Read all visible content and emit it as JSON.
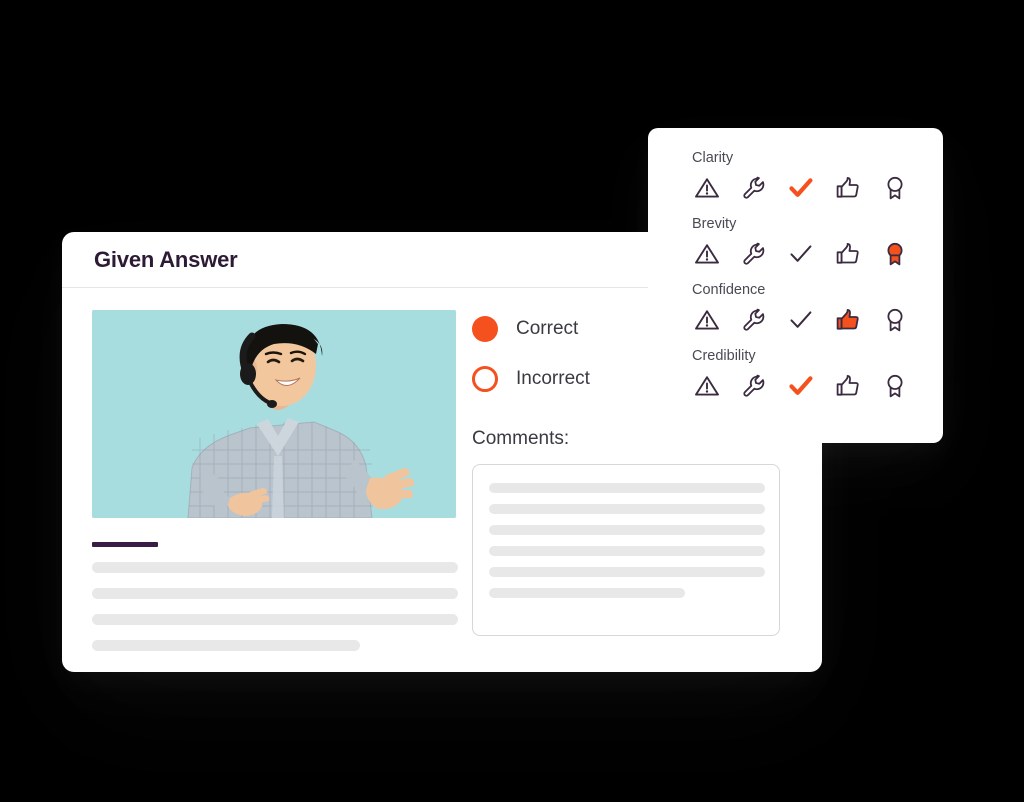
{
  "background_color": "#000000",
  "theme": {
    "accent_orange": "#f4511e",
    "title_purple": "#2d1b36",
    "accent_rule_color": "#3a1b45",
    "photo_background": "#a8dde0",
    "skeleton_gray": "#e8e8e8",
    "icon_outline": "#3b2b40"
  },
  "answer_card": {
    "title": "Given Answer",
    "photo": {
      "alt": "Smiling support agent wearing a headset, gesturing with both hands",
      "background_color": "#a8dde0"
    },
    "left_placeholder_lines": [
      {
        "width": "full"
      },
      {
        "width": "full"
      },
      {
        "width": "full"
      },
      {
        "width": "short"
      }
    ],
    "choices": [
      {
        "label": "Correct",
        "state": "selected",
        "icon": "radio-filled-icon"
      },
      {
        "label": "Incorrect",
        "state": "unselected",
        "icon": "radio-hollow-icon"
      }
    ],
    "comments": {
      "label": "Comments:",
      "placeholder_lines": [
        {
          "width": "full"
        },
        {
          "width": "full"
        },
        {
          "width": "full"
        },
        {
          "width": "full"
        },
        {
          "width": "full"
        },
        {
          "width": "short"
        }
      ]
    }
  },
  "rating_panel": {
    "icon_set": [
      {
        "name": "warning-triangle-icon",
        "label": "Warning"
      },
      {
        "name": "wrench-icon",
        "label": "Needs work"
      },
      {
        "name": "check-icon",
        "label": "Good"
      },
      {
        "name": "thumbs-up-icon",
        "label": "Great"
      },
      {
        "name": "award-ribbon-icon",
        "label": "Excellent"
      }
    ],
    "criteria": [
      {
        "label": "Clarity",
        "selected_index": 2,
        "selected_icon": "check-icon"
      },
      {
        "label": "Brevity",
        "selected_index": 4,
        "selected_icon": "award-ribbon-icon"
      },
      {
        "label": "Confidence",
        "selected_index": 3,
        "selected_icon": "thumbs-up-icon"
      },
      {
        "label": "Credibility",
        "selected_index": 2,
        "selected_icon": "check-icon"
      }
    ]
  }
}
